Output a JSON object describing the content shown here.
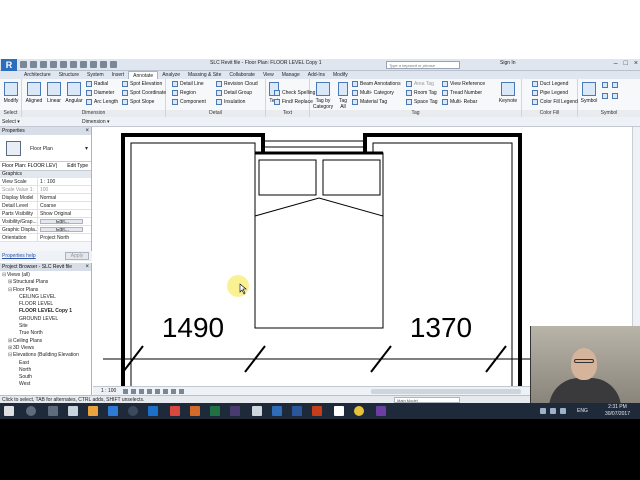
{
  "window": {
    "title": "SLC Revit file - Floor Plan: FLOOR LEVEL Copy 1",
    "search_placeholder": "Type a keyword or phrase",
    "signin": "Sign In",
    "app_letter": "R"
  },
  "tabs": [
    "Architecture",
    "Structure",
    "System",
    "Insert",
    "Annotate",
    "Analyze",
    "Massing & Site",
    "Collaborate",
    "View",
    "Manage",
    "Add-Ins",
    "Modify"
  ],
  "ribbon": {
    "modify": "Modify",
    "dim_buttons": [
      "Aligned",
      "Linear",
      "Angular"
    ],
    "dim_small": [
      "Radial",
      "Diameter",
      "Arc Length"
    ],
    "spot": [
      "Spot Elevation",
      "Spot Coordinate",
      "Spot Slope"
    ],
    "detail": [
      "Detail Line",
      "Region",
      "Component"
    ],
    "detail2": [
      "Revision Cloud",
      "Detail Group",
      "Insulation"
    ],
    "text_big": "Text",
    "text_small": [
      "Check Spelling",
      "Find/ Replace"
    ],
    "tag_big": [
      "Tag by Category",
      "Tag All"
    ],
    "tag_small": [
      "Beam Annotations",
      "Multi- Category",
      "Material Tag"
    ],
    "tag_small2": [
      "Area Tag",
      "Room Tag",
      "Space Tag"
    ],
    "tag_small3": [
      "View Reference",
      "Tread Number",
      "Multi- Rebar"
    ],
    "keynote": "Keynote",
    "colorfill": [
      "Duct Legend",
      "Pipe Legend",
      "Color Fill Legend"
    ],
    "symbol": "Symbol",
    "groups": [
      "Dimension",
      "Detail",
      "Text",
      "Tag",
      "Color Fill",
      "Symbol"
    ],
    "select": "Select"
  },
  "properties": {
    "header": "Properties",
    "type_name": "Floor Plan",
    "instance": "Floor Plan: FLOOR LEV|",
    "edit_type": "Edit Type",
    "group": "Graphics",
    "rows": [
      {
        "k": "View Scale",
        "v": "1 : 100"
      },
      {
        "k": "Scale Value 1:",
        "v": "100"
      },
      {
        "k": "Display Model",
        "v": "Normal"
      },
      {
        "k": "Detail Level",
        "v": "Coarse"
      },
      {
        "k": "Parts Visibility",
        "v": "Show Original"
      },
      {
        "k": "Visibility/Grap...",
        "v": "Edit..."
      },
      {
        "k": "Graphic Displa...",
        "v": "Edit..."
      },
      {
        "k": "Orientation",
        "v": "Project North"
      }
    ],
    "help": "Properties help",
    "apply": "Apply"
  },
  "browser": {
    "header": "Project Browser - SLC Revit file",
    "nodes": [
      {
        "label": "Views (all)",
        "indent": 0,
        "tog": "⊟"
      },
      {
        "label": "Structural Plans",
        "indent": 1,
        "tog": "⊞"
      },
      {
        "label": "Floor Plans",
        "indent": 1,
        "tog": "⊟"
      },
      {
        "label": "CEILING LEVEL",
        "indent": 2,
        "tog": ""
      },
      {
        "label": "FLOOR LEVEL",
        "indent": 2,
        "tog": ""
      },
      {
        "label": "FLOOR LEVEL Copy 1",
        "indent": 2,
        "tog": "",
        "bold": true
      },
      {
        "label": "GROUND LEVEL",
        "indent": 2,
        "tog": ""
      },
      {
        "label": "Site",
        "indent": 2,
        "tog": ""
      },
      {
        "label": "True North",
        "indent": 2,
        "tog": ""
      },
      {
        "label": "Ceiling Plans",
        "indent": 1,
        "tog": "⊞"
      },
      {
        "label": "3D Views",
        "indent": 1,
        "tog": "⊞"
      },
      {
        "label": "Elevations (Building Elevation",
        "indent": 1,
        "tog": "⊟"
      },
      {
        "label": "East",
        "indent": 2,
        "tog": ""
      },
      {
        "label": "North",
        "indent": 2,
        "tog": ""
      },
      {
        "label": "South",
        "indent": 2,
        "tog": ""
      },
      {
        "label": "West",
        "indent": 2,
        "tog": ""
      }
    ]
  },
  "canvas": {
    "dim_left": "1490",
    "dim_right": "1370"
  },
  "viewctl": {
    "scale": "1 : 100"
  },
  "status": {
    "message": "Click to select, TAB for alternates, CTRL adds, SHIFT unselects.",
    "model": "Main Model"
  },
  "taskbar": {
    "time": "2:31 PM",
    "date": "30/07/2017",
    "lang": "ENG"
  }
}
